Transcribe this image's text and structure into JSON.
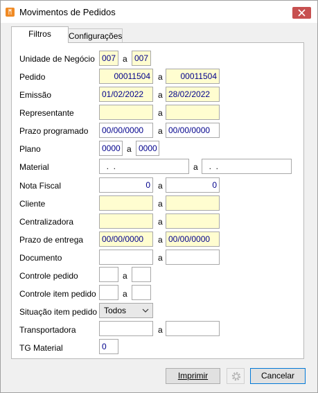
{
  "window": {
    "title": "Movimentos de Pedidos"
  },
  "tabs": [
    {
      "label": "Filtros"
    },
    {
      "label": "Configurações"
    }
  ],
  "form": {
    "unidade_negocio": {
      "label": "Unidade de Negócio",
      "from": "007",
      "sep": "a",
      "to": "007"
    },
    "pedido": {
      "label": "Pedido",
      "from": "00011504",
      "sep": "a",
      "to": "00011504"
    },
    "emissao": {
      "label": "Emissão",
      "from": "01/02/2022",
      "sep": "a",
      "to": "28/02/2022"
    },
    "representante": {
      "label": "Representante",
      "from": "",
      "sep": "a",
      "to": ""
    },
    "prazo_programado": {
      "label": "Prazo programado",
      "from": "00/00/0000",
      "sep": "a",
      "to": "00/00/0000"
    },
    "plano": {
      "label": "Plano",
      "from": "0000",
      "sep": "a",
      "to": "0000"
    },
    "material": {
      "label": "Material",
      "from": "  .  .",
      "sep": "a",
      "to": "  .  ."
    },
    "nota_fiscal": {
      "label": "Nota Fiscal",
      "from": "0",
      "sep": "a",
      "to": "0"
    },
    "cliente": {
      "label": "Cliente",
      "from": "",
      "sep": "a",
      "to": ""
    },
    "centralizadora": {
      "label": "Centralizadora",
      "from": "",
      "sep": "a",
      "to": ""
    },
    "prazo_entrega": {
      "label": "Prazo de entrega",
      "from": "00/00/0000",
      "sep": "a",
      "to": "00/00/0000"
    },
    "documento": {
      "label": "Documento",
      "from": "",
      "sep": "a",
      "to": ""
    },
    "controle_pedido": {
      "label": "Controle pedido",
      "from": "",
      "sep": "a",
      "to": ""
    },
    "controle_item_pedido": {
      "label": "Controle item pedido",
      "from": "",
      "sep": "a",
      "to": ""
    },
    "situacao_item_pedido": {
      "label": "Situação item pedido",
      "value": "Todos"
    },
    "transportadora": {
      "label": "Transportadora",
      "from": "",
      "sep": "a",
      "to": ""
    },
    "tg_material": {
      "label": "TG Material",
      "value": "0"
    }
  },
  "buttons": {
    "print_label": "Imprimir",
    "cancel_label": "Cancelar"
  },
  "icons": {
    "app": "app-icon",
    "close": "close-icon",
    "gear": "gear-icon",
    "dropdown": "chevron-down-icon"
  },
  "colors": {
    "required_field_bg": "#fffdd0",
    "close_button": "#c75050",
    "value_text": "#00008b"
  }
}
